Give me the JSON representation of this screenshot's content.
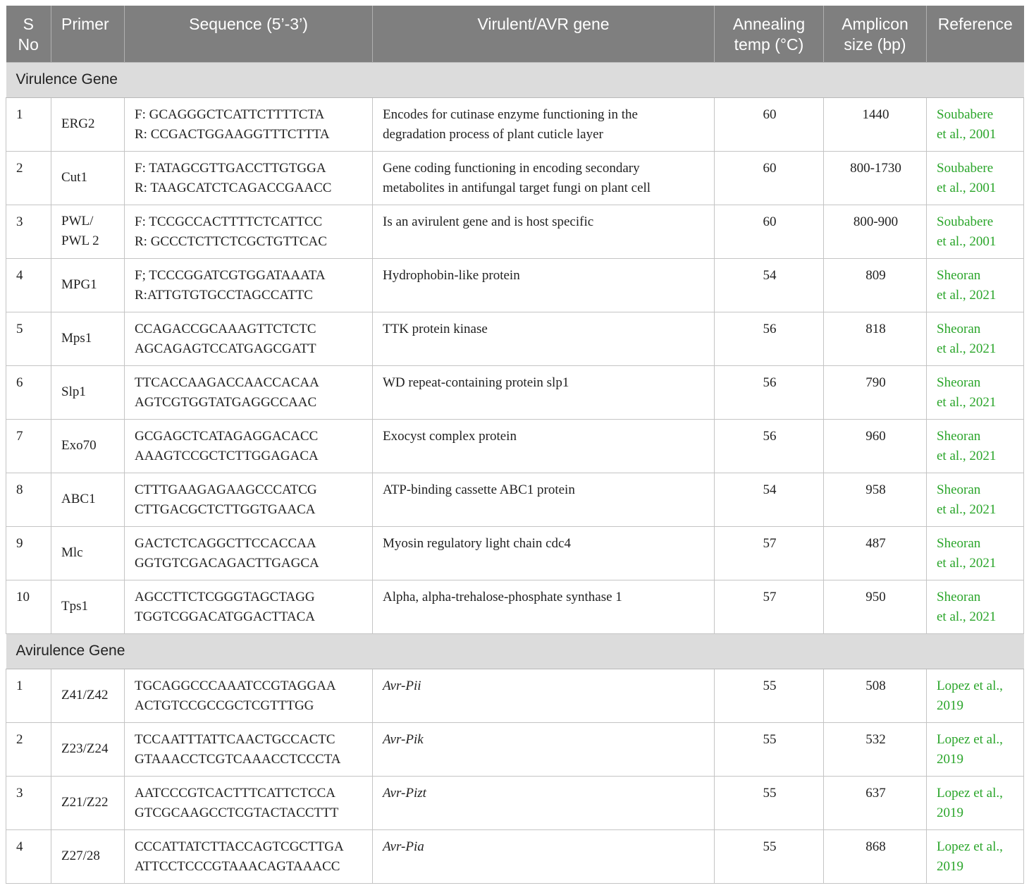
{
  "headers": {
    "sno": [
      "S",
      "No"
    ],
    "primer": "Primer",
    "sequence": "Sequence (5’-3’)",
    "gene": "Virulent/AVR gene",
    "temp": [
      "Annealing",
      "temp (°C)"
    ],
    "size": [
      "Amplicon",
      "size (bp)"
    ],
    "reference": "Reference"
  },
  "sections": [
    {
      "title": "Virulence Gene",
      "rows": [
        {
          "sno": "1",
          "primer": "ERG2",
          "seq": [
            "F: GCAGGGCTCATTCTTTTCTA",
            "R: CCGACTGGAAGGTTTCTTTA"
          ],
          "gene": [
            "Encodes for cutinase enzyme functioning in the",
            "degradation process of plant cuticle layer"
          ],
          "temp": "60",
          "size": "1440",
          "ref": [
            "Soubabere",
            "et al., 2001"
          ]
        },
        {
          "sno": "2",
          "primer": "Cut1",
          "seq": [
            "F: TATAGCGTTGACCTTGTGGA",
            "R: TAAGCATCTCAGACCGAACC"
          ],
          "gene": [
            "Gene coding functioning in encoding secondary",
            "metabolites in antifungal target fungi on plant cell"
          ],
          "temp": "60",
          "size": "800-1730",
          "ref": [
            "Soubabere",
            "et al., 2001"
          ]
        },
        {
          "sno": "3",
          "primer": "PWL/\nPWL 2",
          "seq": [
            "F: TCCGCCACTTTTCTCATTCC",
            "R: GCCCTCTTCTCGCTGTTCAC"
          ],
          "gene": [
            "Is an avirulent gene and is host specific"
          ],
          "temp": "60",
          "size": "800-900",
          "ref": [
            "Soubabere",
            "et al., 2001"
          ]
        },
        {
          "sno": "4",
          "primer": "MPG1",
          "seq": [
            "F; TCCCGGATCGTGGATAAATA",
            "R:ATTGTGTGCCTAGCCATTC"
          ],
          "gene": [
            "Hydrophobin-like protein"
          ],
          "temp": "54",
          "size": "809",
          "ref": [
            "Sheoran",
            "et al., 2021"
          ]
        },
        {
          "sno": "5",
          "primer": "Mps1",
          "seq": [
            "CCAGACCGCAAAGTTCTCTC",
            "AGCAGAGTCCATGAGCGATT"
          ],
          "gene": [
            "TTK protein kinase"
          ],
          "temp": "56",
          "size": "818",
          "ref": [
            "Sheoran",
            "et al., 2021"
          ]
        },
        {
          "sno": "6",
          "primer": "Slp1",
          "seq": [
            "TTCACCAAGACCAACCACAA",
            "AGTCGTGGTATGAGGCCAAC"
          ],
          "gene": [
            "WD repeat-containing protein slp1"
          ],
          "temp": "56",
          "size": "790",
          "ref": [
            "Sheoran",
            "et al., 2021"
          ]
        },
        {
          "sno": "7",
          "primer": "Exo70",
          "seq": [
            "GCGAGCTCATAGAGGACACC",
            "AAAGTCCGCTCTTGGAGACA"
          ],
          "gene": [
            "Exocyst complex protein"
          ],
          "temp": "56",
          "size": "960",
          "ref": [
            "Sheoran",
            "et al., 2021"
          ]
        },
        {
          "sno": "8",
          "primer": "ABC1",
          "seq": [
            "CTTTGAAGAGAAGCCCATCG",
            "CTTGACGCTCTTGGTGAACA"
          ],
          "gene": [
            "ATP-binding cassette ABC1 protein"
          ],
          "temp": "54",
          "size": "958",
          "ref": [
            "Sheoran",
            "et al., 2021"
          ]
        },
        {
          "sno": "9",
          "primer": "Mlc",
          "seq": [
            "GACTCTCAGGCTTCCACCAA",
            "GGTGTCGACAGACTTGAGCA"
          ],
          "gene": [
            "Myosin regulatory light chain cdc4"
          ],
          "temp": "57",
          "size": "487",
          "ref": [
            "Sheoran",
            "et al., 2021"
          ]
        },
        {
          "sno": "10",
          "primer": "Tps1",
          "seq": [
            "AGCCTTCTCGGGTAGCTAGG",
            "TGGTCGGACATGGACTTACA"
          ],
          "gene": [
            "Alpha, alpha-trehalose-phosphate synthase 1"
          ],
          "temp": "57",
          "size": "950",
          "ref": [
            "Sheoran",
            "et al., 2021"
          ]
        }
      ]
    },
    {
      "title": "Avirulence Gene",
      "rows": [
        {
          "sno": "1",
          "primer": "Z41/Z42",
          "seq": [
            "TGCAGGCCCAAATCCGTAGGAA",
            "ACTGTCCGCCGCTCGTTTGG"
          ],
          "gene": [
            "Avr-Pii"
          ],
          "italic": true,
          "temp": "55",
          "size": "508",
          "ref": [
            "Lopez et al.,",
            "2019"
          ]
        },
        {
          "sno": "2",
          "primer": "Z23/Z24",
          "seq": [
            "TCCAATTTATTCAACTGCCACTC",
            "GTAAACCTCGTCAAACCTCCCTA"
          ],
          "gene": [
            "Avr-Pik"
          ],
          "italic": true,
          "temp": "55",
          "size": "532",
          "ref": [
            "Lopez et al.,",
            "2019"
          ]
        },
        {
          "sno": "3",
          "primer": "Z21/Z22",
          "seq": [
            "AATCCCGTCACTTTCATTCTCCA",
            "GTCGCAAGCCTCGTACTACCTTT"
          ],
          "gene": [
            "Avr-Pizt"
          ],
          "italic": true,
          "temp": "55",
          "size": "637",
          "ref": [
            "Lopez et al.,",
            "2019"
          ]
        },
        {
          "sno": "4",
          "primer": "Z27/28",
          "seq": [
            "CCCATTATCTTACCAGTCGCTTGA",
            "ATTCCTCCCGTAAACAGTAAACC"
          ],
          "gene": [
            "Avr-Pia"
          ],
          "italic": true,
          "temp": "55",
          "size": "868",
          "ref": [
            "Lopez et al.,",
            "2019"
          ]
        }
      ]
    }
  ],
  "colors": {
    "header_bg": "#7f7f7f",
    "section_bg": "#dcdcdc",
    "reference_link": "#2aa52a"
  }
}
